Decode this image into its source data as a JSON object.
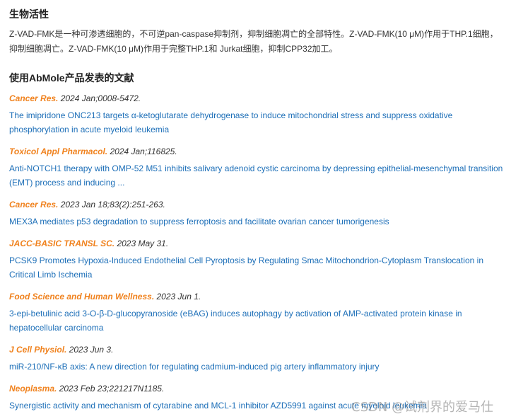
{
  "bio": {
    "title": "生物活性",
    "line1": "Z-VAD-FMK是一种可渗透细胞的，不可逆pan-caspase抑制剂，抑制细胞凋亡的全部特性。Z-VAD-FMK(10 μM)作用于THP.1细胞，",
    "line2": "抑制细胞凋亡。Z-VAD-FMK(10 μM)作用于完整THP.1和 Jurkat细胞，抑制CPP32加工。"
  },
  "publications": {
    "title": "使用AbMole产品发表的文献",
    "items": [
      {
        "journal": "Cancer Res.",
        "citation": " 2024 Jan;0008-5472.",
        "article_line1": "The imipridone ONC213 targets α-ketoglutarate dehydrogenase to induce mitochondrial stress and suppress oxidative",
        "article_line2": "phosphorylation in acute myeloid leukemia"
      },
      {
        "journal": "Toxicol Appl Pharmacol.",
        "citation": " 2024 Jan;116825.",
        "article_line1": "Anti-NOTCH1 therapy with OMP-52 M51 inhibits salivary adenoid cystic carcinoma by depressing epithelial-mesenchymal transition",
        "article_line2": "(EMT) process and inducing ..."
      },
      {
        "journal": "Cancer Res.",
        "citation": " 2023 Jan 18;83(2):251-263.",
        "article_line1": "MEX3A mediates p53 degradation to suppress ferroptosis and facilitate ovarian cancer tumorigenesis",
        "article_line2": ""
      },
      {
        "journal": "JACC-BASIC TRANSL SC.",
        "citation": " 2023 May 31.",
        "article_line1": "PCSK9 Promotes Hypoxia-Induced Endothelial Cell Pyroptosis by Regulating Smac Mitochondrion-Cytoplasm Translocation in",
        "article_line2": "Critical Limb Ischemia"
      },
      {
        "journal": "Food Science and Human Wellness.",
        "citation": " 2023 Jun 1.",
        "article_line1": "3-epi-betulinic acid 3-O-β-D-glucopyranoside (eBAG) induces autophagy by activation of AMP-activated protein kinase in",
        "article_line2": "hepatocellular carcinoma"
      },
      {
        "journal": "J Cell Physiol.",
        "citation": " 2023 Jun 3.",
        "article_line1": "miR-210/NF-κB axis: A new direction for regulating cadmium-induced pig artery inflammatory injury",
        "article_line2": ""
      },
      {
        "journal": "Neoplasma.",
        "citation": " 2023 Feb 23;221217N1185.",
        "article_line1": "Synergistic activity and mechanism of cytarabine and MCL-1 inhibitor AZD5991 against acute myeloid leukemia",
        "article_line2": ""
      }
    ]
  },
  "watermark": "CSDN @试剂界的爱马仕",
  "colors": {
    "journal": "#f0821e",
    "link": "#1d6fb8",
    "text": "#333333"
  }
}
